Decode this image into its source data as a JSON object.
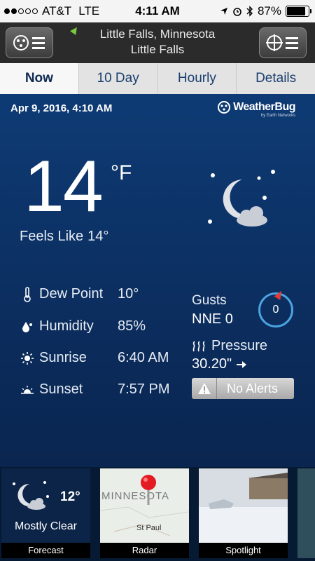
{
  "status_bar": {
    "carrier": "AT&T",
    "network": "LTE",
    "time": "4:11 AM",
    "battery": "87%",
    "battery_level": 0.87
  },
  "header": {
    "city": "Little Falls, Minnesota",
    "station": "Little Falls"
  },
  "tabs": [
    "Now",
    "10 Day",
    "Hourly",
    "Details"
  ],
  "active_tab": "Now",
  "main": {
    "date": "Apr 9, 2016, 4:10 AM",
    "logo": "WeatherBug",
    "logo_sub": "by Earth Networks",
    "temperature": "14",
    "unit": "°F",
    "feels_like_label": "Feels Like",
    "feels_like": "14°",
    "details": [
      {
        "label": "Dew Point",
        "value": "10°",
        "icon": "thermometer-icon"
      },
      {
        "label": "Humidity",
        "value": "85%",
        "icon": "droplet-icon"
      },
      {
        "label": "Sunrise",
        "value": "6:40 AM",
        "icon": "sun-icon"
      },
      {
        "label": "Sunset",
        "value": "7:57 PM",
        "icon": "sunset-icon"
      }
    ],
    "gusts_label": "Gusts",
    "gusts_value": "NNE 0",
    "wind_speed": "0",
    "pressure_label": "Pressure",
    "pressure_value": "30.20\"",
    "alerts_label": "No Alerts"
  },
  "tiles": {
    "forecast": {
      "temp": "12°",
      "condition": "Mostly Clear",
      "caption": "Forecast"
    },
    "radar": {
      "map_label": "MINNESOTA",
      "city_label": "St Paul",
      "caption": "Radar"
    },
    "spotlight": {
      "caption": "Spotlight"
    }
  },
  "colors": {
    "background": "#0b2a57",
    "accent": "#4aa3df",
    "alert_gray": "#a9a9a9",
    "location_arrow": "#7ac943"
  }
}
